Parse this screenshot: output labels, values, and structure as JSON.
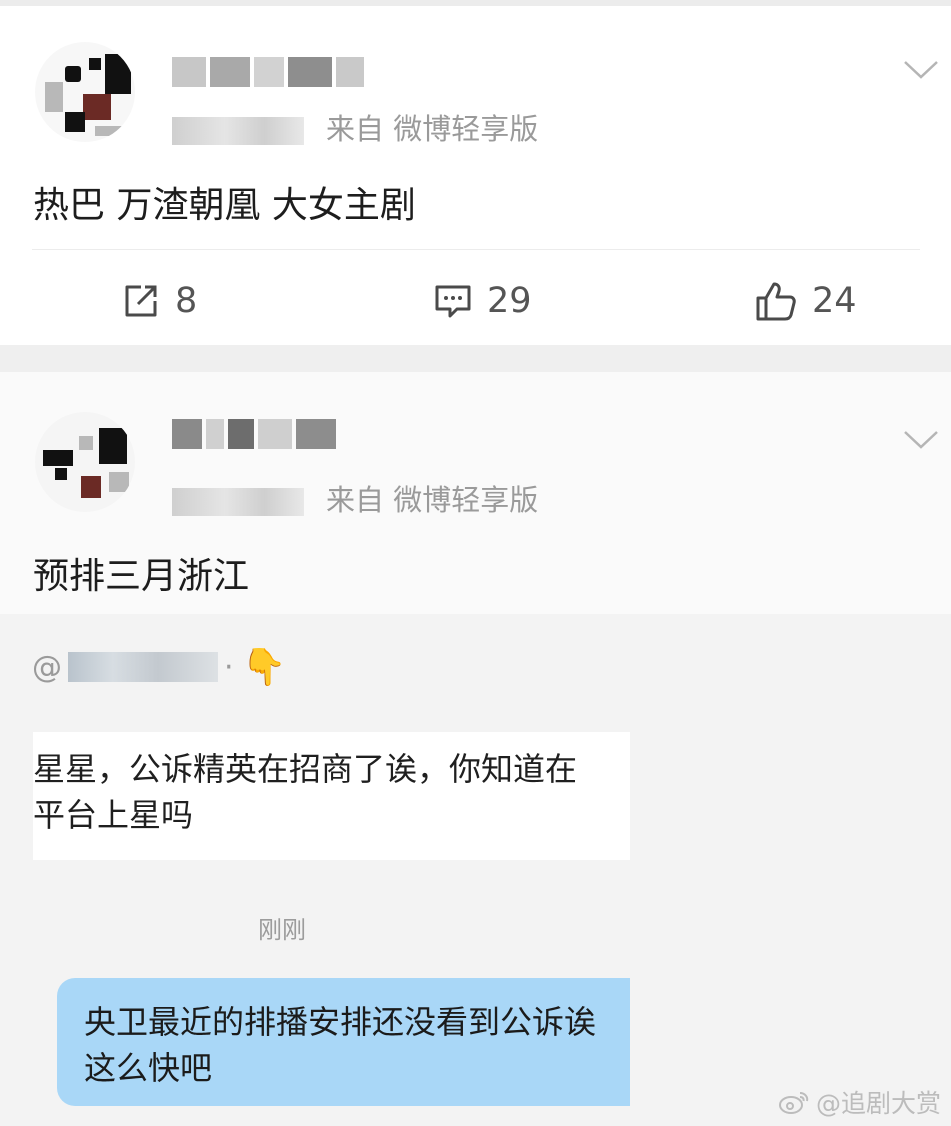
{
  "posts": [
    {
      "meta": {
        "separator": "来自",
        "source": "微博轻享版"
      },
      "text": "热巴 万渣朝凰 大女主剧",
      "actions": {
        "repost_count": "8",
        "comment_count": "29",
        "like_count": "24"
      }
    },
    {
      "meta": {
        "separator": "来自",
        "source": "微博轻享版"
      },
      "text": "预排三月浙江"
    }
  ],
  "chat": {
    "mention_prefix": "@",
    "mention_suffix": "·",
    "incoming": {
      "line1": "星星，公诉精英在招商了诶，你知道在",
      "line2": "平台上星吗"
    },
    "timestamp": "刚刚",
    "outgoing": {
      "line1": "央卫最近的排播安排还没看到公诉诶",
      "line2": "这么快吧"
    }
  },
  "watermark": {
    "handle": "@追剧大赏"
  },
  "icons": {
    "repost": "repost-icon",
    "comment": "comment-icon",
    "like": "like-icon",
    "chevron": "chevron-down-icon",
    "pointing": "pointing-down-hand-icon",
    "weibo": "weibo-logo-icon"
  }
}
